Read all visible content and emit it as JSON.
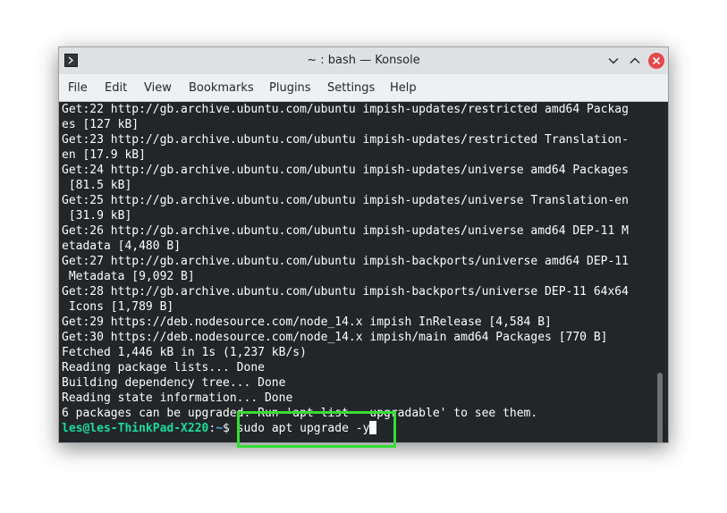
{
  "window": {
    "title": "~ : bash — Konsole"
  },
  "menu": {
    "items": [
      "File",
      "Edit",
      "View",
      "Bookmarks",
      "Plugins",
      "Settings",
      "Help"
    ]
  },
  "terminal": {
    "lines": [
      "Get:22 http://gb.archive.ubuntu.com/ubuntu impish-updates/restricted amd64 Packag",
      "es [127 kB]",
      "Get:23 http://gb.archive.ubuntu.com/ubuntu impish-updates/restricted Translation-",
      "en [17.9 kB]",
      "Get:24 http://gb.archive.ubuntu.com/ubuntu impish-updates/universe amd64 Packages",
      " [81.5 kB]",
      "Get:25 http://gb.archive.ubuntu.com/ubuntu impish-updates/universe Translation-en",
      " [31.9 kB]",
      "Get:26 http://gb.archive.ubuntu.com/ubuntu impish-updates/universe amd64 DEP-11 M",
      "etadata [4,480 B]",
      "Get:27 http://gb.archive.ubuntu.com/ubuntu impish-backports/universe amd64 DEP-11",
      " Metadata [9,092 B]",
      "Get:28 http://gb.archive.ubuntu.com/ubuntu impish-backports/universe DEP-11 64x64",
      " Icons [1,789 B]",
      "Get:29 https://deb.nodesource.com/node_14.x impish InRelease [4,584 B]",
      "Get:30 https://deb.nodesource.com/node_14.x impish/main amd64 Packages [770 B]",
      "Fetched 1,446 kB in 1s (1,237 kB/s)",
      "Reading package lists... Done",
      "Building dependency tree... Done",
      "Reading state information... Done",
      "6 packages can be upgraded. Run 'apt list --upgradable' to see them."
    ],
    "prompt": {
      "user_host": "les@les-ThinkPad-X220",
      "separator": ":",
      "path": "~",
      "symbol": "$ ",
      "command": "sudo apt upgrade -y"
    }
  },
  "colors": {
    "terminal_bg": "#232629",
    "terminal_fg": "#fcfcfc",
    "prompt_user": "#1cdc9a",
    "prompt_path": "#3daee9",
    "highlight": "#33dd33",
    "close_button": "#e5474b"
  },
  "icons": {
    "app": "konsole-icon",
    "minimize": "chevron-down-icon",
    "maximize": "chevron-up-icon",
    "close": "close-icon"
  }
}
